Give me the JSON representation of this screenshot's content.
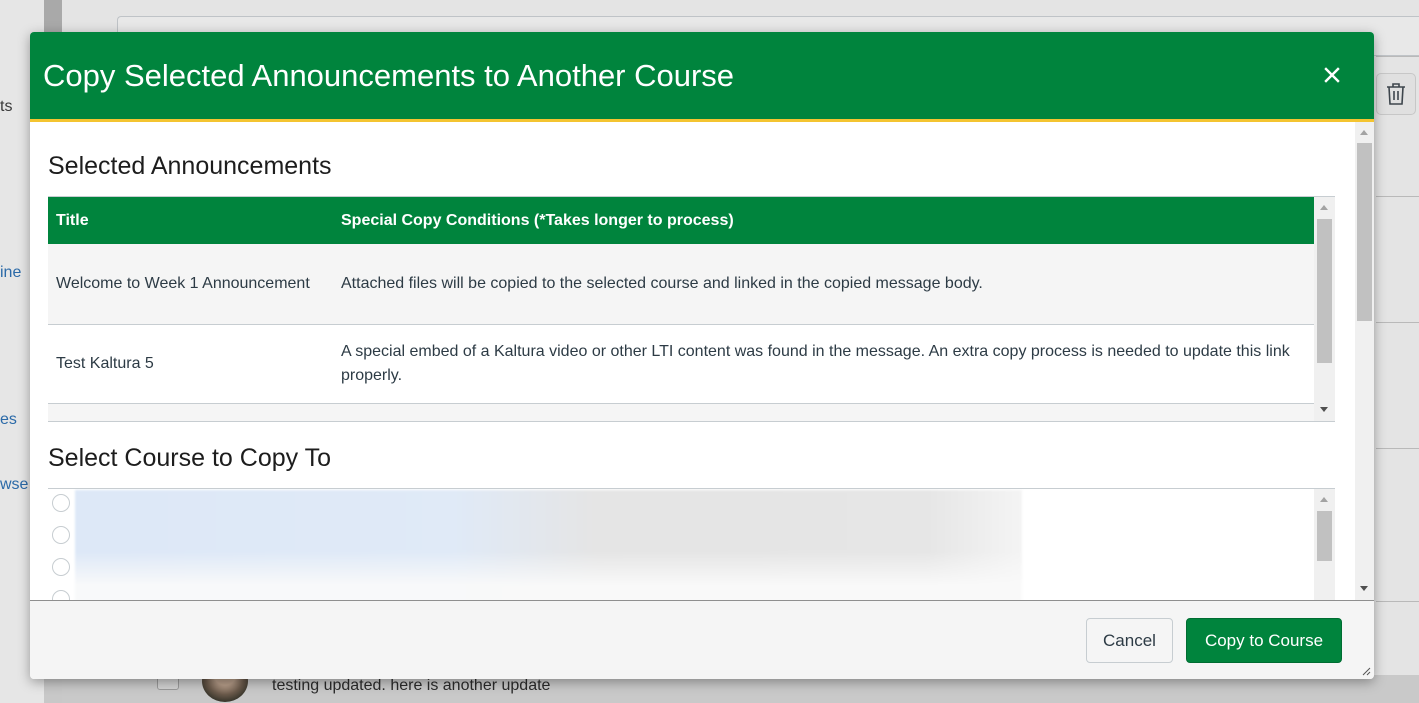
{
  "background": {
    "nav_fragments": [
      "ts",
      "ine",
      "es",
      "wse"
    ],
    "bottom_message": "testing updated. here is another update"
  },
  "modal": {
    "title": "Copy Selected Announcements to Another Course",
    "close_icon": "close-icon",
    "selected_section_title": "Selected Announcements",
    "table": {
      "columns": [
        "Title",
        "Special Copy Conditions (*Takes longer to process)"
      ],
      "rows": [
        {
          "title": "Welcome to Week 1 Announcement",
          "condition": "Attached files will be copied to the selected course and linked in the copied message body."
        },
        {
          "title": "Test Kaltura 5",
          "condition": "A special embed of a Kaltura video or other LTI content was found in the message. An extra copy process is needed to update this link properly."
        }
      ]
    },
    "course_section_title": "Select Course to Copy To",
    "course_options_visible": 4,
    "cancel_label": "Cancel",
    "copy_label": "Copy to Course"
  },
  "colors": {
    "header_green": "#00843d",
    "header_accent": "#f4c430",
    "link_blue": "#2b6aa8"
  }
}
